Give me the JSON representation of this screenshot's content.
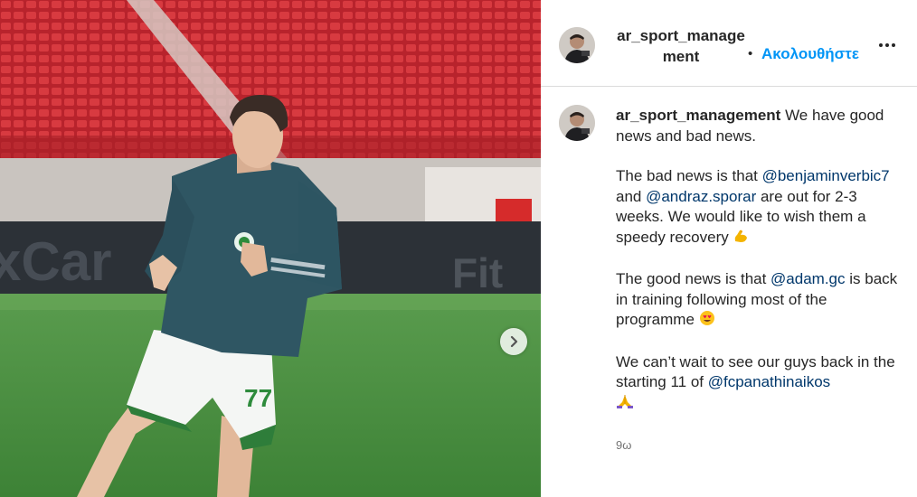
{
  "post": {
    "username": "ar_sport_management",
    "follow_label": "Ακολουθήστε",
    "separator": "•",
    "more_label": "more-options"
  },
  "caption": {
    "username": "ar_sport_management",
    "line1": " We have good news and bad news.",
    "p2_a": "The bad news is that ",
    "mention1": "@benjaminverbic7",
    "p2_b": " and ",
    "mention2": "@andraz.sporar",
    "p2_c": " are out for 2-3 weeks. We would like to wish them a speedy recovery ",
    "p3_a": "The good news is that ",
    "mention3": "@adam.gc",
    "p3_b": " is back in training following most of the programme ",
    "p4_a": "We can’t wait to see our guys back in the starting 11 of ",
    "mention4": "@fcpanathinaikos",
    "time": "9ω"
  },
  "icons": {
    "flexed_biceps": "flexed-biceps-emoji",
    "heart_eyes": "heart-eyes-emoji",
    "folded_hands": "folded-hands-emoji",
    "next": "chevron-right-icon"
  },
  "colors": {
    "link": "#0095f6",
    "mention": "#00376b",
    "text": "#262626",
    "muted": "#737373"
  }
}
